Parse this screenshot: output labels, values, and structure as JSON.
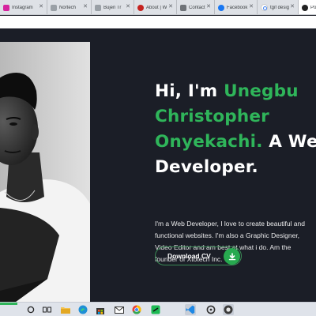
{
  "browser": {
    "tabs": [
      {
        "label": "Instagram",
        "favicon": "instagram-icon",
        "color": "#d6249f",
        "active": false
      },
      {
        "label": "Nortech",
        "favicon": "page-icon",
        "color": "#9aa0a6",
        "active": false
      },
      {
        "label": "Bujen Tr",
        "favicon": "page-icon",
        "color": "#9aa0a6",
        "active": false
      },
      {
        "label": "About | W",
        "favicon": "link-icon",
        "color": "#c5221f",
        "active": false
      },
      {
        "label": "Contact",
        "favicon": "mail-icon",
        "color": "#6f7378",
        "active": false
      },
      {
        "label": "Facebook",
        "favicon": "facebook-icon",
        "color": "#1877f2",
        "active": false
      },
      {
        "label": "tgif desig",
        "favicon": "google-icon",
        "color": "#4285f4",
        "active": false
      },
      {
        "label": "Po",
        "favicon": "github-icon",
        "color": "#222222",
        "active": true
      }
    ]
  },
  "hero": {
    "greeting": "Hi, I'm",
    "name_line1": "Unegbu",
    "name_line2": "Christopher",
    "name_line3": "Onyekachi.",
    "role_prefix": "A Web",
    "role_suffix": "Developer.",
    "bio": [
      "I'm a Web Developer, I love to create beautiful and",
      "functional websites. I'm also a Graphic Designer,",
      "Video Editor and am best at what i do. Am the",
      "founder of Xtotech Inc."
    ],
    "cta_label": "Download CV",
    "accent_color": "#2fb55a"
  },
  "taskbar": {
    "items": [
      {
        "name": "search-icon"
      },
      {
        "name": "task-view-icon"
      },
      {
        "name": "file-explorer-icon"
      },
      {
        "name": "edge-browser-icon"
      },
      {
        "name": "store-icon"
      },
      {
        "name": "mail-icon"
      },
      {
        "name": "chrome-icon"
      },
      {
        "name": "green-app-icon"
      },
      {
        "name": "vscode-icon"
      },
      {
        "name": "settings-icon"
      },
      {
        "name": "github-desktop-icon"
      }
    ]
  }
}
